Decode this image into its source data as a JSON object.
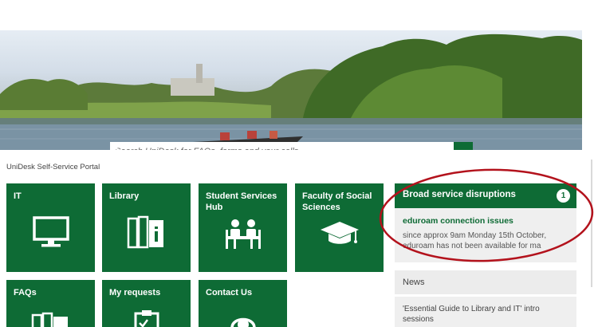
{
  "search": {
    "placeholder": "Search UniDesk for FAQs, forms and your calls"
  },
  "portal": {
    "title": "UniDesk Self-Service Portal"
  },
  "tiles": [
    {
      "label": "IT",
      "icon": "monitor-icon"
    },
    {
      "label": "Library",
      "icon": "books-icon"
    },
    {
      "label": "Student Services Hub",
      "icon": "meeting-icon"
    },
    {
      "label": "Faculty of Social Sciences",
      "icon": "graduation-cap-icon"
    },
    {
      "label": "FAQs",
      "icon": "books-icon"
    },
    {
      "label": "My requests",
      "icon": "clipboard-icon"
    },
    {
      "label": "Contact Us",
      "icon": "headset-icon"
    }
  ],
  "disruptions": {
    "title": "Broad service disruptions",
    "count": "1",
    "item_title": "eduroam connection issues",
    "item_text": "since approx 9am Monday 15th October, eduroam has not been available for ma"
  },
  "news": {
    "title": "News",
    "item": "'Essential Guide to Library and IT' intro sessions"
  },
  "colors": {
    "brand_green": "#0e6b35",
    "annotation_red": "#b3121c"
  }
}
